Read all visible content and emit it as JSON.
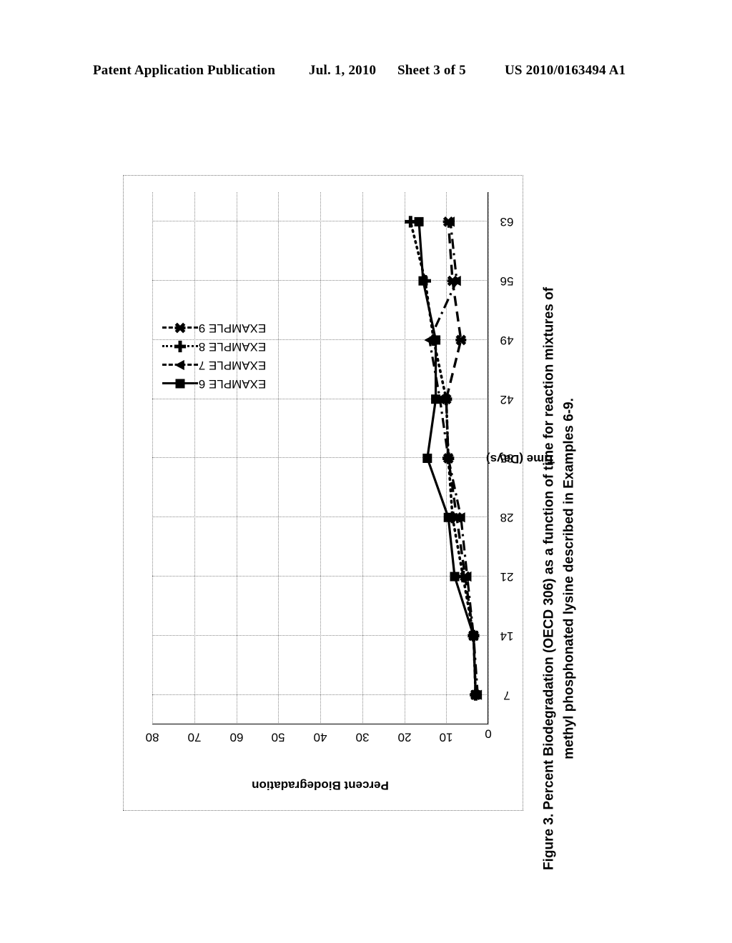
{
  "header": {
    "publication": "Patent Application Publication",
    "date": "Jul. 1, 2010",
    "sheet": "Sheet 3 of 5",
    "doc_number": "US 2010/0163494 A1"
  },
  "figure": {
    "caption": "Figure 3. Percent Biodegradation (OECD 306) as a function of time for reaction mixtures of methyl phosphonated lysine described in Examples 6-9."
  },
  "chart_data": {
    "type": "line",
    "title": "",
    "xlabel": "Time (Days)",
    "ylabel": "Percent Biodegradation",
    "x": [
      7,
      14,
      21,
      28,
      35,
      42,
      49,
      56,
      63
    ],
    "xtick_labels": [
      "7",
      "14",
      "21",
      "28",
      "35",
      "42",
      "49",
      "56",
      "63"
    ],
    "ytick_labels": [
      "0",
      "10",
      "20",
      "30",
      "40",
      "50",
      "60",
      "70",
      "80"
    ],
    "yticks": [
      0,
      10,
      20,
      30,
      40,
      50,
      60,
      70,
      80
    ],
    "ylim": [
      0,
      80
    ],
    "grid": true,
    "legend_position": "top-center",
    "orientation": "rotated-90-ccw",
    "series": [
      {
        "name": "EXAMPLE 6",
        "marker": "square",
        "line_style": "solid",
        "color": "#000000",
        "values": [
          3.0,
          3.5,
          8.0,
          9.5,
          14.5,
          12.5,
          12.5,
          15.5,
          16.5
        ]
      },
      {
        "name": "EXAMPLE 7",
        "marker": "triangle",
        "line_style": "dash-dot",
        "color": "#000000",
        "values": [
          2.5,
          3.5,
          5.0,
          6.5,
          9.5,
          11.5,
          14.0,
          7.5,
          9.0
        ]
      },
      {
        "name": "EXAMPLE 8",
        "marker": "plus",
        "line_style": "dotted",
        "color": "#000000",
        "values": [
          3.0,
          3.5,
          6.0,
          8.5,
          9.5,
          10.0,
          13.0,
          15.0,
          18.5
        ]
      },
      {
        "name": "EXAMPLE 9",
        "marker": "cross",
        "line_style": "dashed",
        "color": "#000000",
        "values": [
          3.0,
          3.5,
          5.5,
          7.5,
          9.5,
          10.0,
          6.5,
          8.5,
          9.5
        ]
      }
    ]
  }
}
